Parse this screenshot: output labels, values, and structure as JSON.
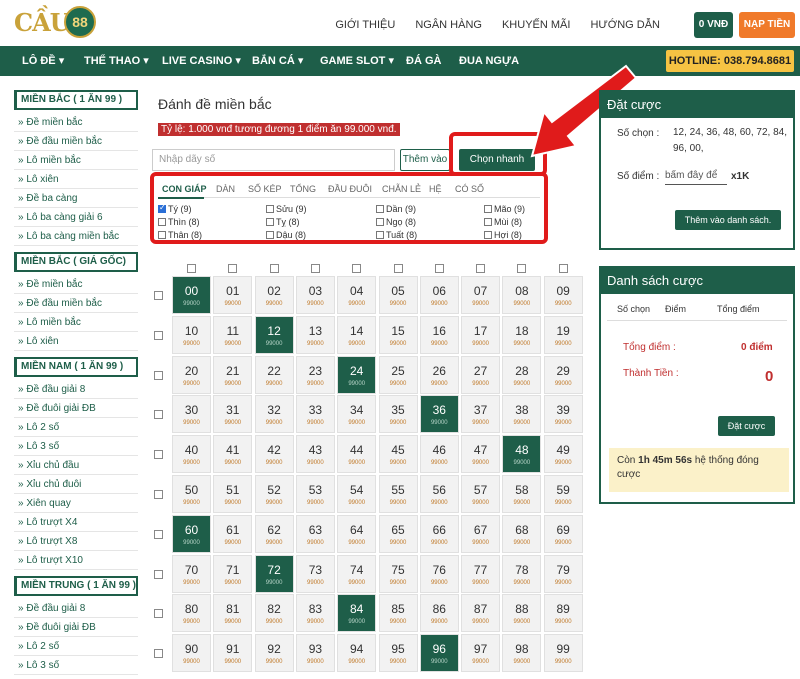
{
  "header": {
    "logo_text": "CẦU",
    "logo_badge": "88",
    "links": [
      "GIỚI THIỆU",
      "NGÂN HÀNG",
      "KHUYẾN MÃI",
      "HƯỚNG DẪN"
    ],
    "balance": "0 VNĐ",
    "deposit": "NẠP TIỀN"
  },
  "nav": {
    "items": [
      "LÔ ĐỀ",
      "THỂ THAO",
      "LIVE CASINO",
      "BẮN CÁ",
      "GAME SLOT",
      "ĐÁ GÀ",
      "ĐUA NGỰA"
    ],
    "hotline": "HOTLINE: 038.794.8681"
  },
  "sidebar": {
    "groups": [
      {
        "title": "MIỀN BẮC ( 1 ĂN 99 )",
        "items": [
          "Đề miền bắc",
          "Đề đầu miền bắc",
          "Lô miền bắc",
          "Lô xiên",
          "Đề ba càng",
          "Lô ba càng giải 6",
          "Lô ba càng miền bắc"
        ]
      },
      {
        "title": "MIỀN BẮC ( GIÁ GỐC)",
        "items": [
          "Đề miền bắc",
          "Đề đầu miền bắc",
          "Lô miền bắc",
          "Lô xiên"
        ]
      },
      {
        "title": "MIỀN NAM ( 1 ĂN 99 )",
        "items": [
          "Đề đầu giải 8",
          "Đề đuôi giải ĐB",
          "Lô 2 số",
          "Lô 3 số",
          "Xỉu chủ đầu",
          "Xỉu chủ đuôi",
          "Xiên quay",
          "Lô trượt X4",
          "Lô trượt X8",
          "Lô trượt X10"
        ]
      },
      {
        "title": "MIỀN TRUNG ( 1 ĂN 99 )",
        "items": [
          "Đề đầu giải 8",
          "Đề đuôi giải ĐB",
          "Lô 2 số",
          "Lô 3 số"
        ]
      }
    ]
  },
  "main": {
    "title": "Đánh đề miền bắc",
    "rate": "Tỷ lệ: 1.000 vnđ tương đương 1 điểm ăn 99.000 vnđ.",
    "input_placeholder": "Nhập dãy số",
    "add_button": "Thêm vào",
    "quick_button": "Chọn nhanh",
    "tabs": [
      "CON GIÁP",
      "DÀN",
      "SỐ KÉP",
      "TỔNG",
      "ĐẦU ĐUÔI",
      "CHẴN LẺ",
      "HỆ",
      "CÓ SỐ"
    ],
    "zodiac": [
      {
        "label": "Tý (9)",
        "checked": true
      },
      {
        "label": "Sửu (9)",
        "checked": false
      },
      {
        "label": "Dần (9)",
        "checked": false
      },
      {
        "label": "Mão (9)",
        "checked": false
      },
      {
        "label": "Thìn (8)",
        "checked": false
      },
      {
        "label": "Tỵ (8)",
        "checked": false
      },
      {
        "label": "Ngọ (8)",
        "checked": false
      },
      {
        "label": "Mùi (8)",
        "checked": false
      },
      {
        "label": "Thân (8)",
        "checked": false
      },
      {
        "label": "Dậu (8)",
        "checked": false
      },
      {
        "label": "Tuất (8)",
        "checked": false
      },
      {
        "label": "Hợi (8)",
        "checked": false
      }
    ],
    "cell_sub": "99000",
    "selected_numbers": [
      "00",
      "12",
      "24",
      "36",
      "48",
      "60",
      "72",
      "84",
      "96"
    ]
  },
  "bet_panel": {
    "title": "Đặt cược",
    "chosen_label": "Số chọn :",
    "chosen_values": "12, 24, 36, 48, 60, 72, 84, 96, 00,",
    "points_label": "Số điểm :",
    "points_placeholder": "bấm đây để",
    "multiplier": "x1K",
    "add_list_button": "Thêm vào danh sách."
  },
  "list_panel": {
    "title": "Danh sách cược",
    "col_chosen": "Số chọn",
    "col_points": "Điểm",
    "col_total": "Tổng điểm",
    "total_label": "Tổng điểm :",
    "total_value": "0 điểm",
    "money_label": "Thành Tiền :",
    "money_value": "0",
    "bet_button": "Đặt cược",
    "notice_prefix": "Còn",
    "notice_time": "1h 45m 56s",
    "notice_suffix": "hệ thống đóng cược"
  },
  "colors": {
    "brand": "#1e5e49",
    "accent": "#f07a2a",
    "highlight": "#e01b1b",
    "hotline": "#f6c343"
  }
}
